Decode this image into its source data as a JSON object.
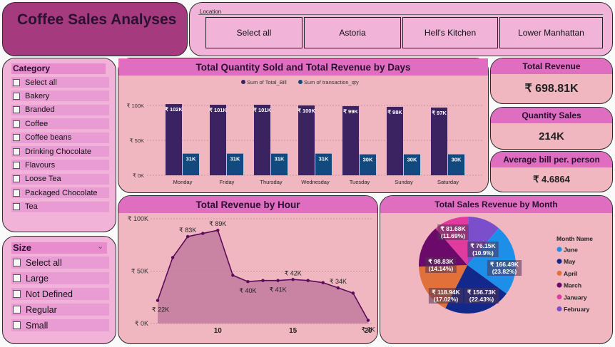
{
  "title": "Coffee Sales Analyses",
  "location": {
    "label": "Location",
    "options": [
      "Select all",
      "Astoria",
      "Hell's Kitchen",
      "Lower Manhattan"
    ]
  },
  "category": {
    "header": "Category",
    "items": [
      "Select all",
      "Bakery",
      "Branded",
      "Coffee",
      "Coffee beans",
      "Drinking Chocolate",
      "Flavours",
      "Loose Tea",
      "Packaged Chocolate",
      "Tea"
    ]
  },
  "size": {
    "header": "Size",
    "items": [
      "Select all",
      "Large",
      "Not Defined",
      "Regular",
      "Small"
    ]
  },
  "cards": {
    "revenue": {
      "label": "Total Revenue",
      "value": "₹ 698.81K"
    },
    "quantity": {
      "label": "Quantity Sales",
      "value": "214K"
    },
    "avg_bill": {
      "label": "Average bill per. person",
      "value": "₹ 4.6864"
    }
  },
  "colors": {
    "bill": "#3b2260",
    "qty": "#124a7e",
    "area_fill": "#c27a9e",
    "line": "#5a0c5a"
  },
  "chart_data": [
    {
      "type": "bar",
      "title": "Total Quantity Sold and Total Revenue by Days",
      "categories": [
        "Monday",
        "Friday",
        "Thursday",
        "Wednesday",
        "Tuesday",
        "Sunday",
        "Saturday"
      ],
      "series": [
        {
          "name": "Sum of Total_Bill",
          "values": [
            102,
            101,
            101,
            100,
            99,
            98,
            97
          ],
          "labels": [
            "₹ 102K",
            "₹ 101K",
            "₹ 101K",
            "₹ 100K",
            "₹ 99K",
            "₹ 98K",
            "₹ 97K"
          ]
        },
        {
          "name": "Sum of transaction_qty",
          "values": [
            31,
            31,
            31,
            31,
            30,
            30,
            30
          ],
          "labels": [
            "31K",
            "31K",
            "31K",
            "31K",
            "30K",
            "30K",
            "30K"
          ]
        }
      ],
      "y_ticks": [
        "₹ 100K",
        "₹ 50K",
        "₹ 0K"
      ],
      "ylim": [
        0,
        100
      ]
    },
    {
      "type": "area",
      "title": "Total Revenue by Hour",
      "x": [
        6,
        7,
        8,
        9,
        10,
        11,
        12,
        13,
        14,
        15,
        16,
        17,
        18,
        19,
        20
      ],
      "values": [
        22,
        63,
        83,
        86,
        89,
        46,
        40,
        41,
        41,
        42,
        41,
        39,
        34,
        29,
        3
      ],
      "point_labels": [
        {
          "x": 6,
          "text": "₹ 22K"
        },
        {
          "x": 8,
          "text": "₹ 83K"
        },
        {
          "x": 10,
          "text": "₹ 89K"
        },
        {
          "x": 12,
          "text": "₹ 40K"
        },
        {
          "x": 14,
          "text": "₹ 41K"
        },
        {
          "x": 15,
          "text": "₹ 42K"
        },
        {
          "x": 18,
          "text": "₹ 34K"
        },
        {
          "x": 20,
          "text": "₹ 3K"
        }
      ],
      "x_ticks": [
        "10",
        "15",
        "20"
      ],
      "y_ticks": [
        "₹ 100K",
        "₹ 50K",
        "₹ 0K"
      ],
      "ylim": [
        0,
        100
      ]
    },
    {
      "type": "pie",
      "title": "Total Sales Revenue by Month",
      "legend_title": "Month Name",
      "slices": [
        {
          "name": "June",
          "value": 166.49,
          "label": "₹ 166.49K (23.82%)",
          "color": "#1e8fe8"
        },
        {
          "name": "May",
          "value": 156.73,
          "label": "₹ 156.73K (22.43%)",
          "color": "#12288a"
        },
        {
          "name": "April",
          "value": 118.94,
          "label": "₹ 118.94K (17.02%)",
          "color": "#e2703a"
        },
        {
          "name": "March",
          "value": 98.83,
          "label": "₹ 98.83K (14.14%)",
          "color": "#6b0a6b"
        },
        {
          "name": "January",
          "value": 81.68,
          "label": "₹ 81.68K (11.69%)",
          "color": "#e23ba0"
        },
        {
          "name": "February",
          "value": 76.15,
          "label": "₹ 76.15K (10.9%)",
          "color": "#7b4fcc"
        }
      ]
    }
  ]
}
